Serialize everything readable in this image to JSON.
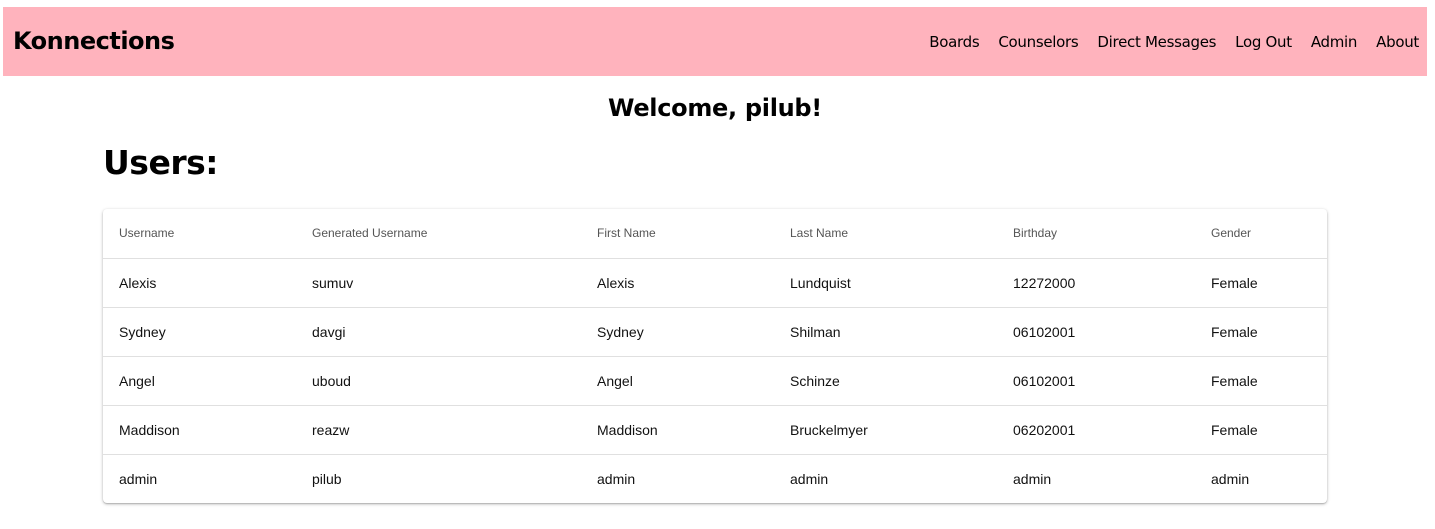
{
  "navbar": {
    "brand": "Konnections",
    "links": [
      "Boards",
      "Counselors",
      "Direct Messages",
      "Log Out",
      "Admin",
      "About"
    ]
  },
  "welcome": "Welcome, pilub!",
  "section_title": "Users:",
  "table": {
    "headers": [
      "Username",
      "Generated Username",
      "First Name",
      "Last Name",
      "Birthday",
      "Gender"
    ],
    "rows": [
      [
        "Alexis",
        "sumuv",
        "Alexis",
        "Lundquist",
        "12272000",
        "Female"
      ],
      [
        "Sydney",
        "davgi",
        "Sydney",
        "Shilman",
        "06102001",
        "Female"
      ],
      [
        "Angel",
        "uboud",
        "Angel",
        "Schinze",
        "06102001",
        "Female"
      ],
      [
        "Maddison",
        "reazw",
        "Maddison",
        "Bruckelmyer",
        "06202001",
        "Female"
      ],
      [
        "admin",
        "pilub",
        "admin",
        "admin",
        "admin",
        "admin"
      ]
    ]
  },
  "colors": {
    "navbar_bg": "#ffb3bd"
  }
}
